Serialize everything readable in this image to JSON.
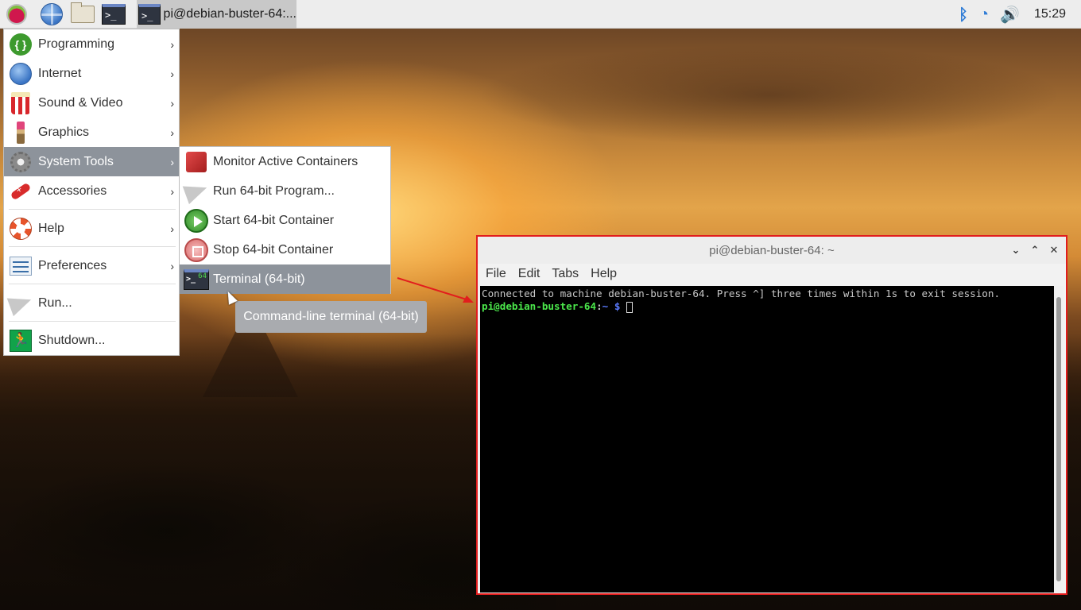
{
  "taskbar": {
    "launchers": [
      {
        "icon": "raspberry-pi-menu-icon"
      },
      {
        "icon": "web-browser-icon"
      },
      {
        "icon": "file-manager-icon"
      },
      {
        "icon": "terminal-icon",
        "glyph": ">_"
      }
    ],
    "task_button": {
      "label": "pi@debian-buster-64:...",
      "glyph": ">_"
    },
    "tray": {
      "bluetooth": "bluetooth-icon",
      "wifi": "wifi-icon",
      "volume": "volume-icon",
      "bt_glyph": "ᛒ",
      "wifi_glyph": "◔",
      "volume_glyph": "🔊"
    },
    "clock": "15:29"
  },
  "menu": {
    "items": [
      {
        "label": "Programming",
        "icon": "programming-icon",
        "glyph": "{ }",
        "submenu": true
      },
      {
        "label": "Internet",
        "icon": "internet-icon",
        "submenu": true
      },
      {
        "label": "Sound & Video",
        "icon": "sound-video-icon",
        "submenu": true
      },
      {
        "label": "Graphics",
        "icon": "graphics-icon",
        "submenu": true
      },
      {
        "label": "System Tools",
        "icon": "system-tools-icon",
        "submenu": true,
        "selected": true
      },
      {
        "label": "Accessories",
        "icon": "accessories-icon",
        "submenu": true
      },
      {
        "label": "Help",
        "icon": "help-icon",
        "submenu": true
      },
      {
        "label": "Preferences",
        "icon": "preferences-icon",
        "submenu": true
      },
      {
        "label": "Run...",
        "icon": "run-icon",
        "submenu": false
      },
      {
        "label": "Shutdown...",
        "icon": "shutdown-icon",
        "glyph": "🏃",
        "submenu": false
      }
    ],
    "arrow_glyph": "›"
  },
  "submenu": {
    "items": [
      {
        "label": "Monitor Active Containers",
        "icon": "monitor-containers-icon"
      },
      {
        "label": "Run 64-bit Program...",
        "icon": "run-program-icon"
      },
      {
        "label": "Start 64-bit Container",
        "icon": "start-container-icon"
      },
      {
        "label": "Stop 64-bit Container",
        "icon": "stop-container-icon"
      },
      {
        "label": "Terminal (64-bit)",
        "icon": "terminal-64-icon",
        "selected": true,
        "glyph": ">_",
        "badge": "64"
      }
    ]
  },
  "tooltip": "Command-line terminal (64-bit)",
  "terminal": {
    "title": "pi@debian-buster-64: ~",
    "controls": {
      "minimize": "⌄",
      "maximize": "⌃",
      "close": "✕"
    },
    "menus": [
      "File",
      "Edit",
      "Tabs",
      "Help"
    ],
    "lines": {
      "message": "Connected to machine debian-buster-64. Press ^] three times within 1s to exit session.",
      "prompt_user": "pi@debian-buster-64",
      "prompt_sep": ":",
      "prompt_path": "~",
      "prompt_symbol": " $ "
    }
  }
}
